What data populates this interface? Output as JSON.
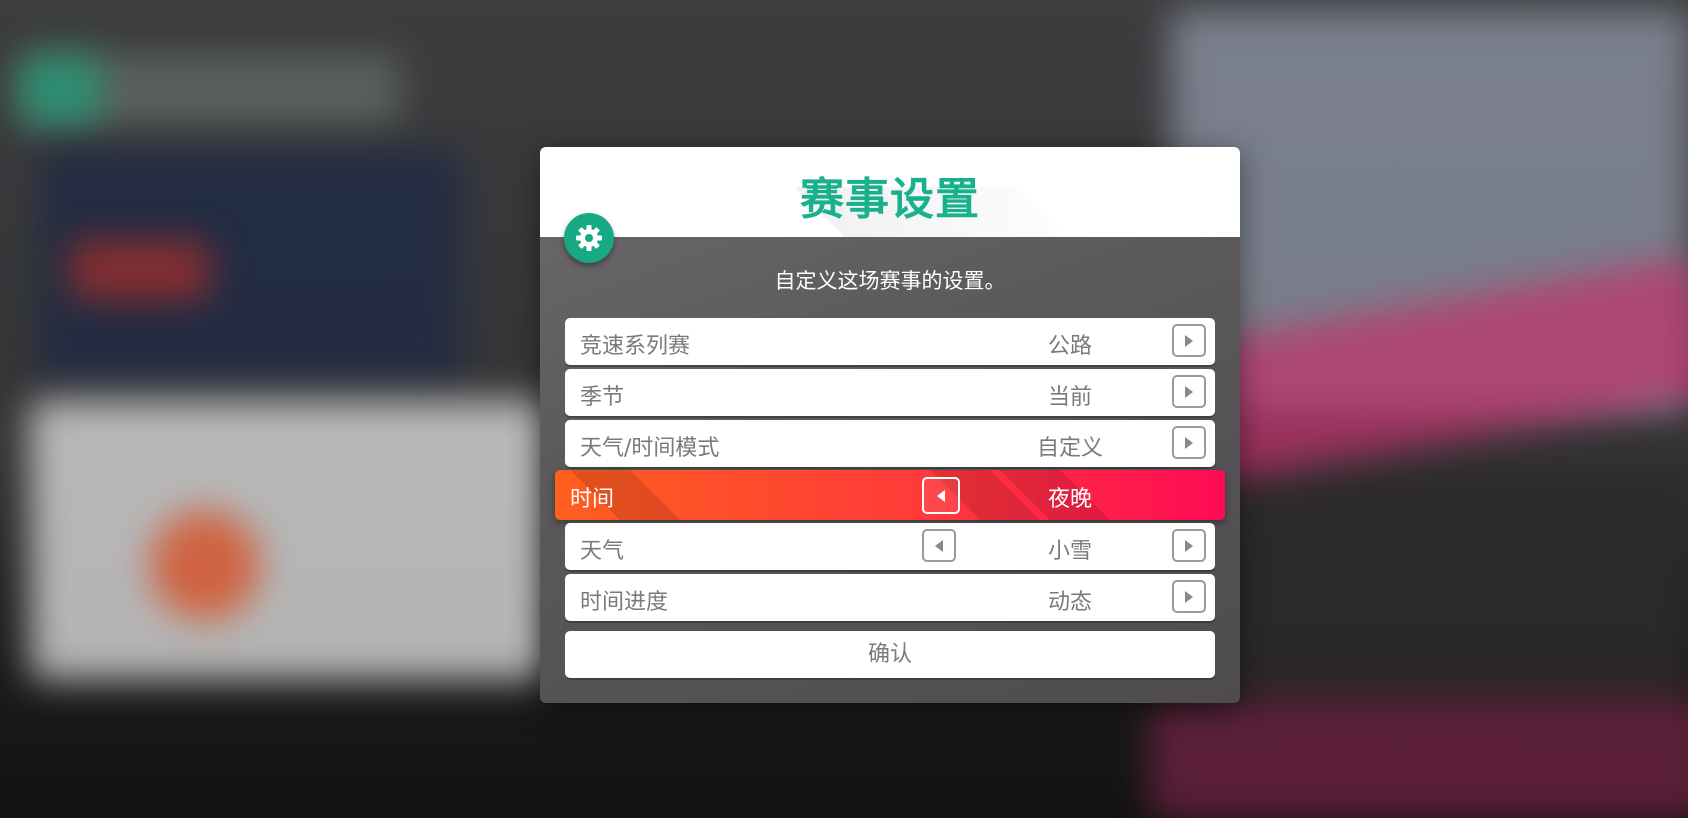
{
  "dialog": {
    "title": "赛事设置",
    "subtitle": "自定义这场赛事的设置。",
    "confirm_label": "确认"
  },
  "settings": [
    {
      "label": "竞速系列赛",
      "value": "公路"
    },
    {
      "label": "季节",
      "value": "当前"
    },
    {
      "label": "天气/时间模式",
      "value": "自定义"
    },
    {
      "label": "时间",
      "value": "夜晚"
    },
    {
      "label": "天气",
      "value": "小雪"
    },
    {
      "label": "时间进度",
      "value": "动态"
    }
  ],
  "icons": {
    "settings": "gear-icon",
    "next": "arrow-right-icon",
    "previous": "arrow-left-icon"
  },
  "colors": {
    "accent": "#19b08e",
    "highlight_start": "#ff5f1f",
    "highlight_end": "#ff0b55"
  }
}
